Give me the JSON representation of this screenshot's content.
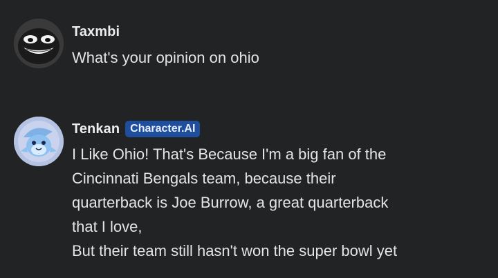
{
  "messages": [
    {
      "author": "Taxmbi",
      "badge": "",
      "avatar_icon": "grinning-face-avatar-icon",
      "lines": [
        "What's your opinion on ohio"
      ]
    },
    {
      "author": "Tenkan",
      "badge": "Character.AI",
      "avatar_icon": "blue-shark-character-avatar-icon",
      "lines": [
        "I Like Ohio! That's Because I'm a big fan of the",
        "Cincinnati Bengals team, because their",
        "quarterback is Joe Burrow, a great quarterback",
        "that I love,",
        "But their team still hasn't won the super bowl yet"
      ]
    }
  ],
  "colors": {
    "background": "#222325",
    "badge_background": "#1f4e9d",
    "text": "#e5e5e5"
  }
}
